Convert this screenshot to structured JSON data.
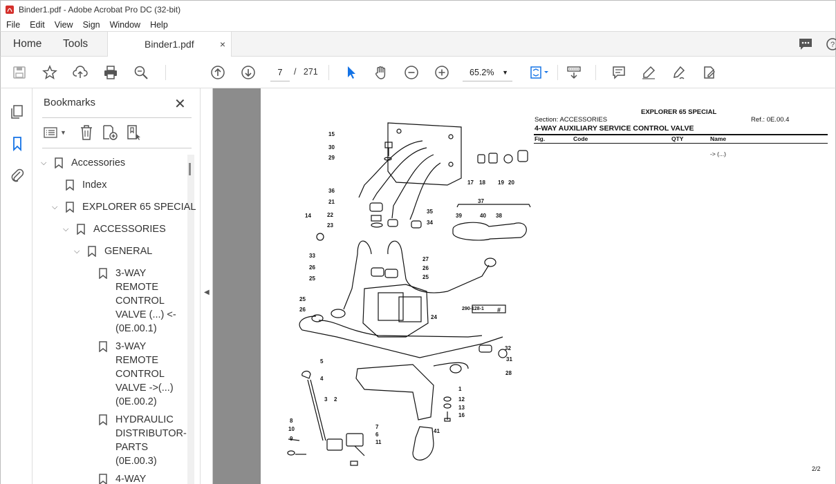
{
  "window": {
    "title": "Binder1.pdf - Adobe Acrobat Pro DC (32-bit)"
  },
  "menu": {
    "items": [
      "File",
      "Edit",
      "View",
      "Sign",
      "Window",
      "Help"
    ]
  },
  "tabs": {
    "home": "Home",
    "tools": "Tools",
    "doc": "Binder1.pdf",
    "doc_close": "×"
  },
  "toolbar": {
    "current_page": "7",
    "page_separator": "/",
    "total_pages": "271",
    "zoom": "65.2%"
  },
  "bookmarks": {
    "title": "Bookmarks",
    "close": "✕",
    "items": [
      {
        "label": "Accessories"
      },
      {
        "label": "Index"
      },
      {
        "label": "EXPLORER 65 SPECIAL"
      },
      {
        "label": "ACCESSORIES"
      },
      {
        "label": "GENERAL"
      },
      {
        "lines": [
          "3-WAY",
          "REMOTE",
          "CONTROL",
          "VALVE (...) <-",
          "(0E.00.1)"
        ]
      },
      {
        "lines": [
          "3-WAY",
          "REMOTE",
          "CONTROL",
          "VALVE ->(...)",
          "(0E.00.2)"
        ]
      },
      {
        "lines": [
          "HYDRAULIC",
          "DISTRIBUTOR-",
          "PARTS",
          "(0E.00.3)"
        ]
      },
      {
        "lines": [
          "4-WAY"
        ]
      }
    ]
  },
  "page": {
    "header_title": "EXPLORER 65 SPECIAL",
    "section": "Section: ACCESSORIES",
    "ref": "Ref.: 0E.00.4",
    "heading": "4-WAY AUXILIARY SERVICE CONTROL VALVE",
    "columns": [
      "Fig.",
      "Code",
      "QTY",
      "Name"
    ],
    "row_name": "-> (...)",
    "drawing_code": "290-128-1",
    "drawing_mark": "#",
    "page_num": "2/2",
    "callouts": [
      "15",
      "30",
      "29",
      "17",
      "18",
      "19",
      "20",
      "36",
      "21",
      "22",
      "23",
      "14",
      "35",
      "34",
      "37",
      "39",
      "40",
      "38",
      "33",
      "26",
      "25",
      "27",
      "26",
      "25",
      "25",
      "26",
      "24",
      "32",
      "31",
      "28",
      "5",
      "4",
      "3",
      "2",
      "1",
      "12",
      "13",
      "16",
      "8",
      "10",
      "9",
      "7",
      "6",
      "11",
      "41"
    ]
  },
  "colors": {
    "accent": "#1473e6",
    "doc_gray": "#8c8c8c",
    "panel_border": "#dddddd"
  }
}
